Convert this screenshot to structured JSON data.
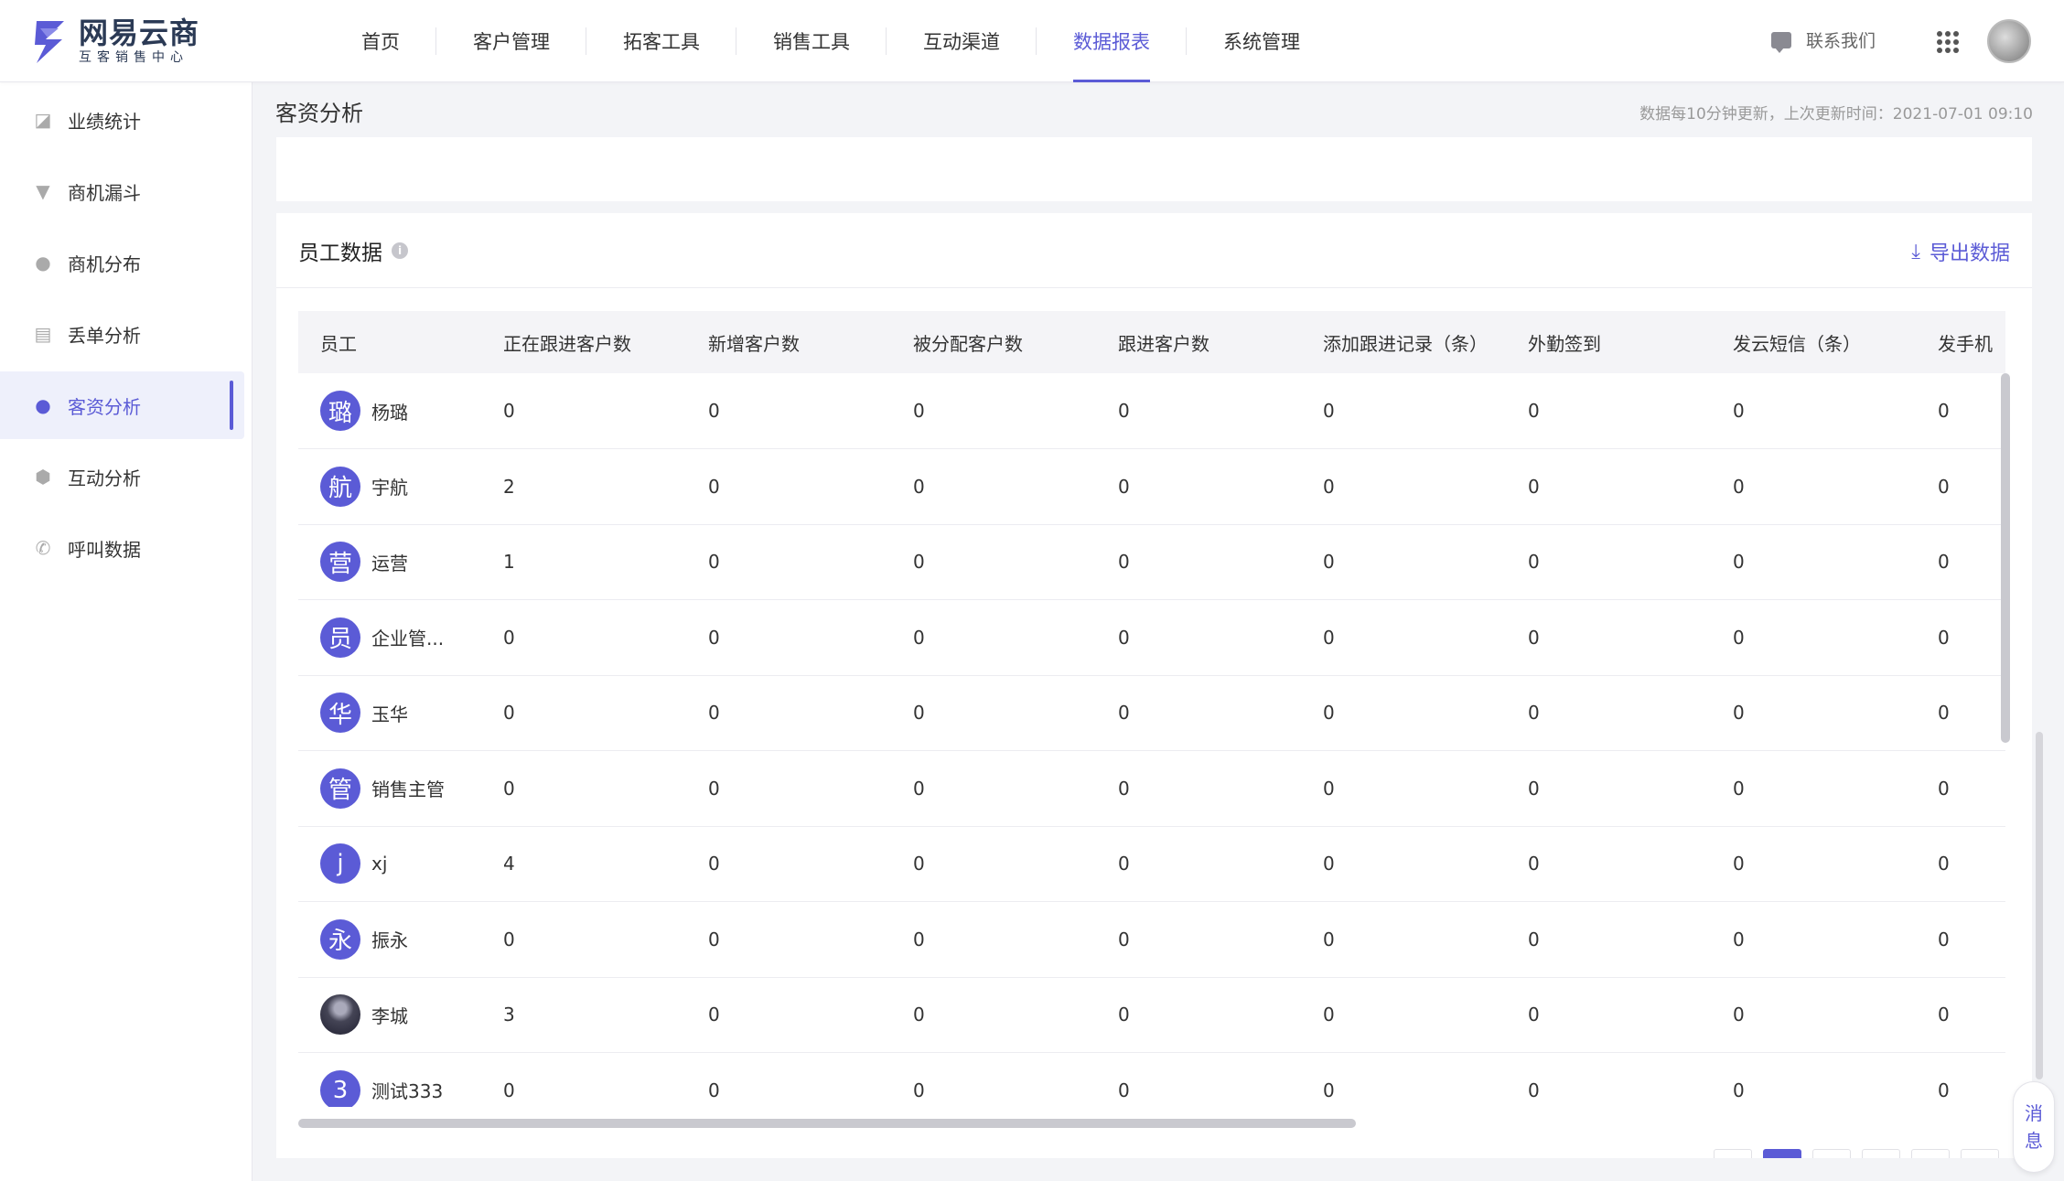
{
  "brand": {
    "name": "网易云商",
    "sub": "互客销售中心",
    "accent": "#5b5bd6"
  },
  "nav": [
    {
      "label": "首页"
    },
    {
      "label": "客户管理"
    },
    {
      "label": "拓客工具"
    },
    {
      "label": "销售工具"
    },
    {
      "label": "互动渠道"
    },
    {
      "label": "数据报表",
      "active": true
    },
    {
      "label": "系统管理"
    }
  ],
  "header": {
    "contact_label": "联系我们",
    "apps_icon": "grid-icon",
    "avatar": "user-avatar"
  },
  "sidebar": {
    "items": [
      {
        "label": "业绩统计",
        "icon": "chart-icon"
      },
      {
        "label": "商机漏斗",
        "icon": "funnel-icon"
      },
      {
        "label": "商机分布",
        "icon": "cluster-icon"
      },
      {
        "label": "丢单分析",
        "icon": "document-icon"
      },
      {
        "label": "客资分析",
        "icon": "user-icon",
        "active": true
      },
      {
        "label": "互动分析",
        "icon": "cube-icon"
      },
      {
        "label": "呼叫数据",
        "icon": "phone-icon"
      }
    ]
  },
  "page": {
    "title": "客资分析",
    "update_note": "数据每10分钟更新，上次更新时间：2021-07-01 09:10"
  },
  "card": {
    "title": "员工数据",
    "info_icon": "info-icon",
    "export_label": "导出数据"
  },
  "table": {
    "columns": [
      "员工",
      "正在跟进客户数",
      "新增客户数",
      "被分配客户数",
      "跟进客户数",
      "添加跟进记录（条）",
      "外勤签到",
      "发云短信（条）",
      "发手机"
    ],
    "rows": [
      {
        "avatar": "璐",
        "name": "杨璐",
        "values": [
          "0",
          "0",
          "0",
          "0",
          "0",
          "0",
          "0",
          "0"
        ]
      },
      {
        "avatar": "航",
        "name": "宇航",
        "values": [
          "2",
          "0",
          "0",
          "0",
          "0",
          "0",
          "0",
          "0"
        ]
      },
      {
        "avatar": "营",
        "name": "运营",
        "values": [
          "1",
          "0",
          "0",
          "0",
          "0",
          "0",
          "0",
          "0"
        ]
      },
      {
        "avatar": "员",
        "name": "企业管...",
        "values": [
          "0",
          "0",
          "0",
          "0",
          "0",
          "0",
          "0",
          "0"
        ]
      },
      {
        "avatar": "华",
        "name": "玉华",
        "values": [
          "0",
          "0",
          "0",
          "0",
          "0",
          "0",
          "0",
          "0"
        ]
      },
      {
        "avatar": "管",
        "name": "销售主管",
        "values": [
          "0",
          "0",
          "0",
          "0",
          "0",
          "0",
          "0",
          "0"
        ]
      },
      {
        "avatar": "j",
        "name": "xj",
        "values": [
          "4",
          "0",
          "0",
          "0",
          "0",
          "0",
          "0",
          "0"
        ]
      },
      {
        "avatar": "永",
        "name": "振永",
        "values": [
          "0",
          "0",
          "0",
          "0",
          "0",
          "0",
          "0",
          "0"
        ]
      },
      {
        "avatar": "",
        "photo": true,
        "name": "李城",
        "values": [
          "3",
          "0",
          "0",
          "0",
          "0",
          "0",
          "0",
          "0"
        ]
      },
      {
        "avatar": "3",
        "name": "测试333",
        "values": [
          "0",
          "0",
          "0",
          "0",
          "0",
          "0",
          "0",
          "0"
        ]
      }
    ]
  },
  "message_button": {
    "line1": "消",
    "line2": "息"
  }
}
